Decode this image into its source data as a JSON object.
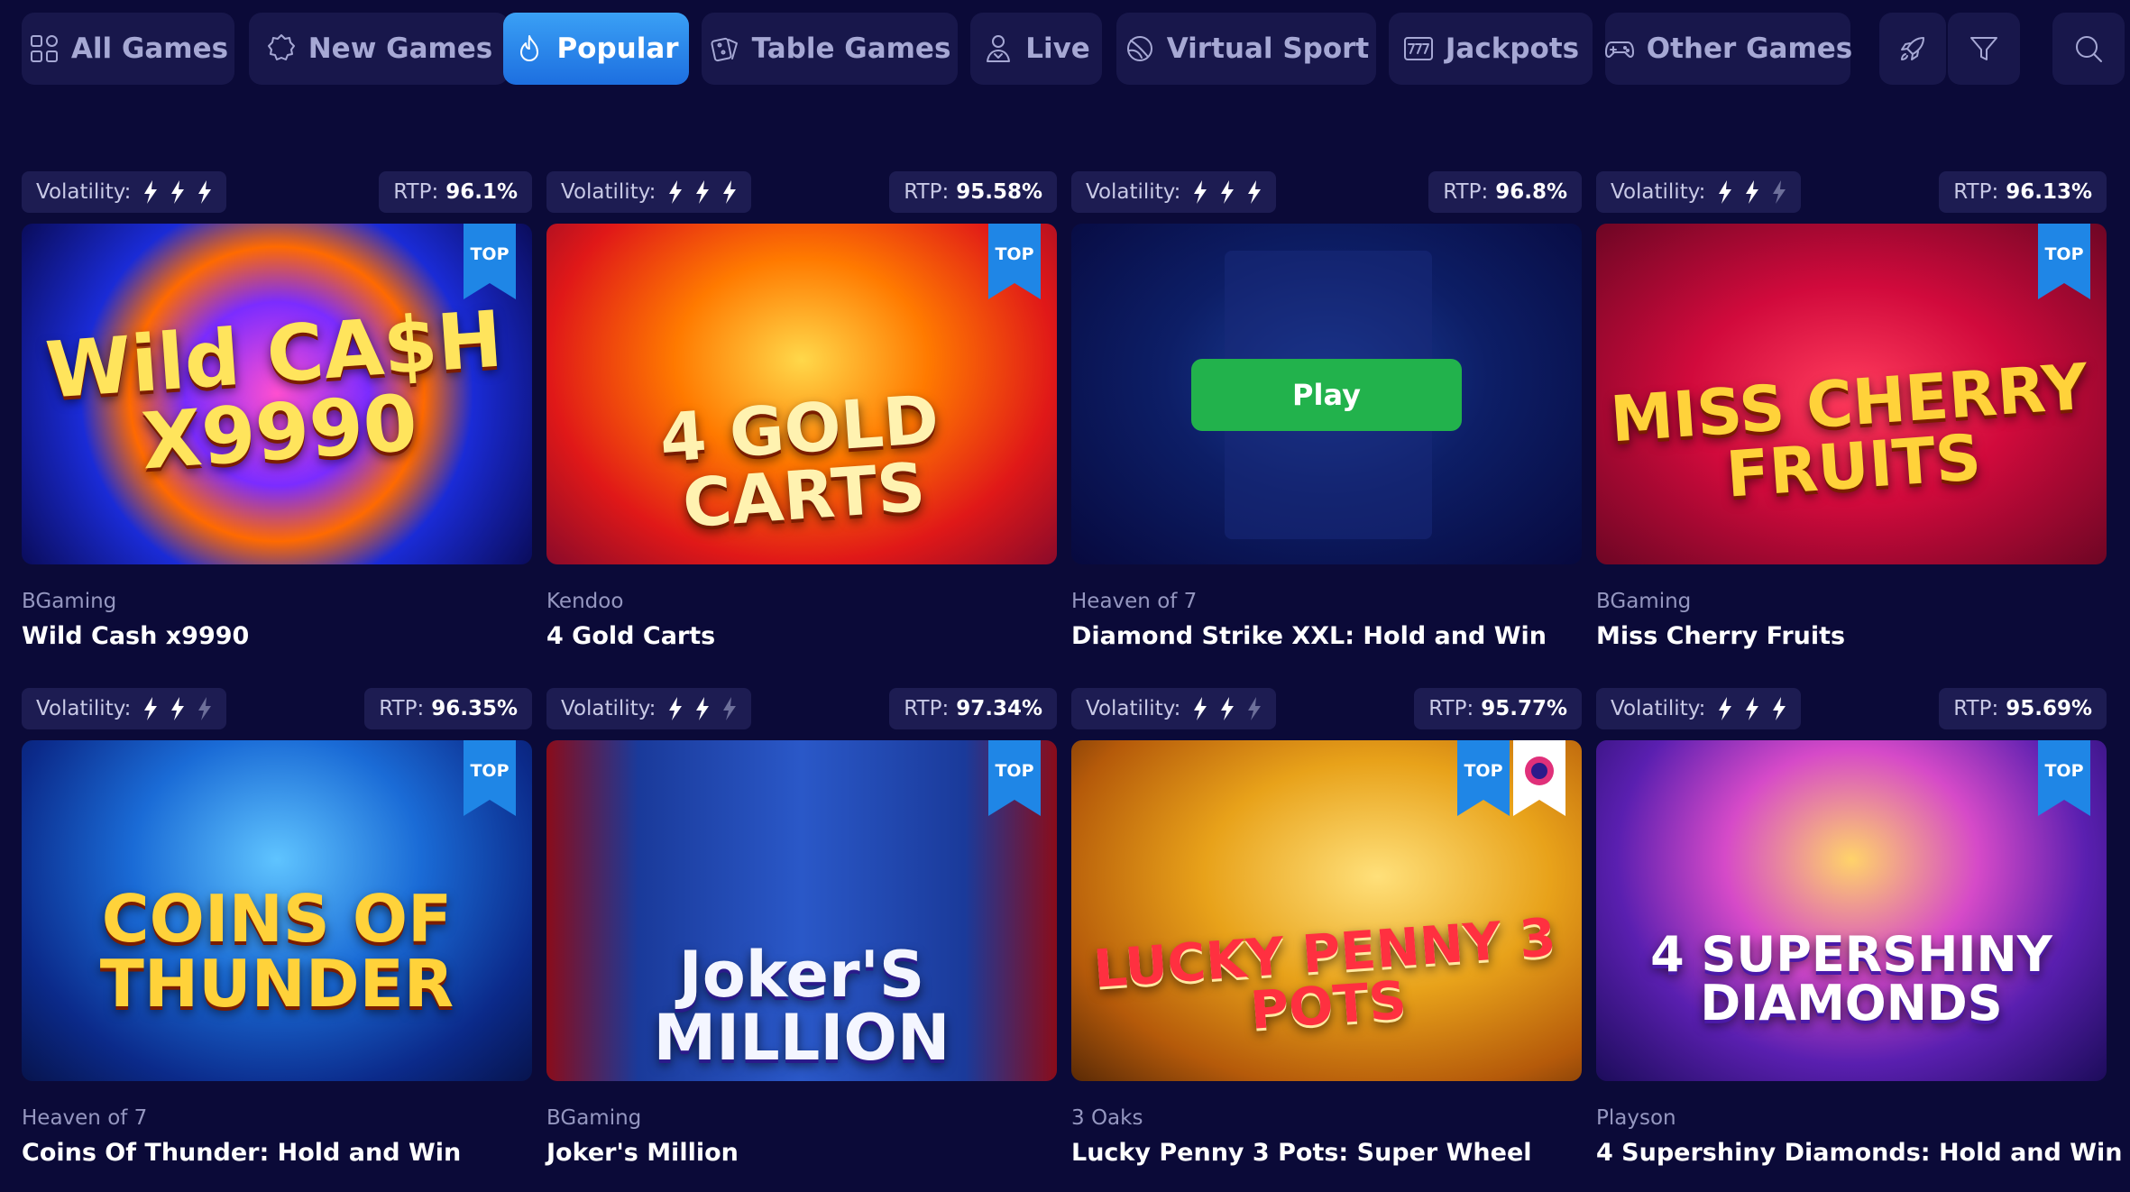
{
  "nav": {
    "items": [
      {
        "label": "All Games",
        "icon": "grid-icon",
        "active": false
      },
      {
        "label": "New Games",
        "icon": "new-badge-icon",
        "active": false
      },
      {
        "label": "Popular",
        "icon": "flame-icon",
        "active": true
      },
      {
        "label": "Table Games",
        "icon": "dice-icon",
        "active": false
      },
      {
        "label": "Live",
        "icon": "dealer-icon",
        "active": false
      },
      {
        "label": "Virtual Sport",
        "icon": "ball-icon",
        "active": false
      },
      {
        "label": "Jackpots",
        "icon": "777-icon",
        "active": false
      },
      {
        "label": "Other Games",
        "icon": "gamepad-icon",
        "active": false
      }
    ],
    "icon_buttons": [
      "rocket-icon",
      "filter-icon",
      "search-icon"
    ],
    "active_color": "#2a8cef"
  },
  "labels": {
    "volatility": "Volatility:",
    "rtp": "RTP:",
    "top": "TOP",
    "play": "Play"
  },
  "games": [
    {
      "provider": "BGaming",
      "name": "Wild Cash x9990",
      "rtp": "96.1%",
      "volatility": 3,
      "top": true,
      "art": "Wild CA$H X9990"
    },
    {
      "provider": "Kendoo",
      "name": "4 Gold Carts",
      "rtp": "95.58%",
      "volatility": 3,
      "top": true,
      "art": "4 GOLD CARTS"
    },
    {
      "provider": "Heaven of 7",
      "name": "Diamond Strike XXL: Hold and Win",
      "rtp": "96.8%",
      "volatility": 3,
      "top": false,
      "hovered": true
    },
    {
      "provider": "BGaming",
      "name": "Miss Cherry Fruits",
      "rtp": "96.13%",
      "volatility": 2,
      "top": true,
      "art": "MISS CHERRY FRUITS"
    },
    {
      "provider": "Heaven of 7",
      "name": "Coins Of Thunder: Hold and Win",
      "rtp": "96.35%",
      "volatility": 2,
      "top": true,
      "art": "COINS OF THUNDER"
    },
    {
      "provider": "BGaming",
      "name": "Joker's Million",
      "rtp": "97.34%",
      "volatility": 2,
      "top": true,
      "art": "Joker'S MILLION"
    },
    {
      "provider": "3 Oaks",
      "name": "Lucky Penny 3 Pots: Super Wheel",
      "rtp": "95.77%",
      "volatility": 2,
      "top": true,
      "art": "LUCKY PENNY 3 POTS"
    },
    {
      "provider": "Playson",
      "name": "4 Supershiny Diamonds: Hold and Win",
      "rtp": "95.69%",
      "volatility": 3,
      "top": true,
      "art": "4 SUPERSHINY DIAMONDS"
    }
  ]
}
